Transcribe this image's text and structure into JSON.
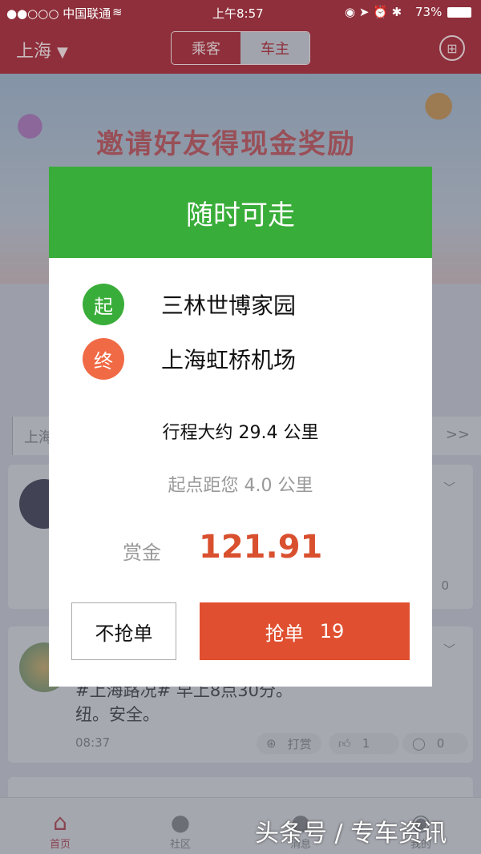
{
  "status": {
    "carrier": "●●○○○ 中国联通",
    "time": "上午8:57",
    "battery": "73%"
  },
  "header": {
    "city": "上海",
    "tabs": [
      "乘客",
      "车主"
    ],
    "active_tab": "车主"
  },
  "banner": {
    "title": "邀请好友得现金奖励"
  },
  "search": {
    "value": "上海",
    "more": ">>"
  },
  "cards": [
    {
      "like": "",
      "comment": "0"
    },
    {
      "text_line1": "#上海路况# 早上8点30分。",
      "text_line2": "纽。安全。",
      "time": "08:37",
      "tip": "打赏",
      "like": "1",
      "comment": "0"
    }
  ],
  "tabbar": [
    {
      "label": "首页",
      "icon": "home-icon"
    },
    {
      "label": "社区",
      "icon": "community-icon"
    },
    {
      "label": "消息",
      "icon": "message-icon"
    },
    {
      "label": "我的",
      "icon": "profile-icon"
    }
  ],
  "modal": {
    "title": "随时可走",
    "start_badge": "起",
    "start": "三林世博家园",
    "end_badge": "终",
    "end": "上海虹桥机场",
    "trip": "行程大约 29.4 公里",
    "pickup": "起点距您 4.0 公里",
    "reward_label": "赏金",
    "reward": "121.91",
    "decline": "不抢单",
    "accept": "抢单",
    "countdown": "19"
  },
  "watermark": "头条号 / 专车资讯",
  "colors": {
    "header": "#8e2f3b",
    "modal_header": "#39ad39",
    "start": "#39ad39",
    "end": "#f06a45",
    "accept": "#e05030",
    "reward": "#d9502f"
  }
}
